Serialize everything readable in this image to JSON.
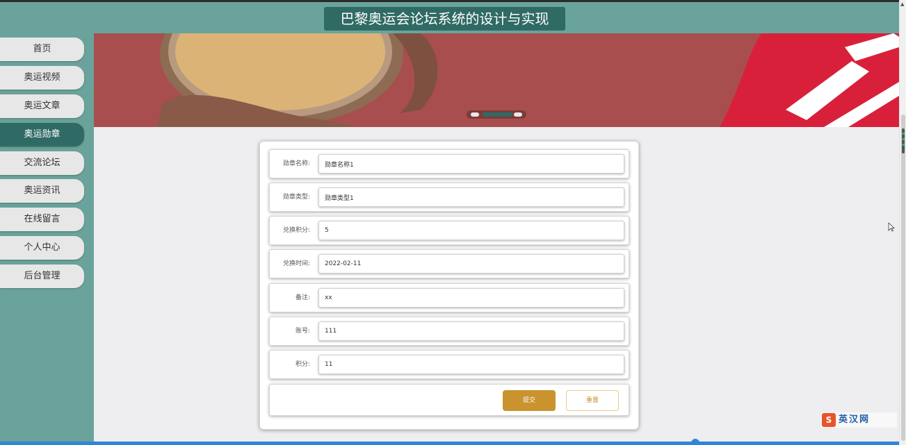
{
  "app": {
    "title": "巴黎奥运会论坛系统的设计与实现"
  },
  "sidebar": {
    "items": [
      {
        "label": "首页"
      },
      {
        "label": "奥运视频"
      },
      {
        "label": "奥运文章"
      },
      {
        "label": "奥运勋章",
        "active": true
      },
      {
        "label": "交流论坛"
      },
      {
        "label": "奥运资讯"
      },
      {
        "label": "在线留言"
      },
      {
        "label": "个人中心"
      },
      {
        "label": "后台管理"
      }
    ]
  },
  "banner": {
    "slide_count": 3,
    "active_slide": 2
  },
  "form": {
    "fields": [
      {
        "label": "勋章名称:",
        "value": "勋章名称1"
      },
      {
        "label": "勋章类型:",
        "value": "勋章类型1"
      },
      {
        "label": "兑换积分:",
        "value": "5"
      },
      {
        "label": "兑换时间:",
        "value": "2022-02-11"
      },
      {
        "label": "备注:",
        "value": "xx"
      },
      {
        "label": "账号:",
        "value": "111"
      },
      {
        "label": "积分:",
        "value": "11"
      }
    ],
    "submit_label": "提交",
    "reset_label": "重置"
  },
  "watermark": {
    "logo_letter": "S",
    "text": "英汉网"
  },
  "colors": {
    "header_bg": "#6aa39b",
    "title_bg": "#2f6a64",
    "nav_active": "#2f6a64",
    "submit_button": "#c9932d",
    "banner_bg": "#a84e4e"
  }
}
